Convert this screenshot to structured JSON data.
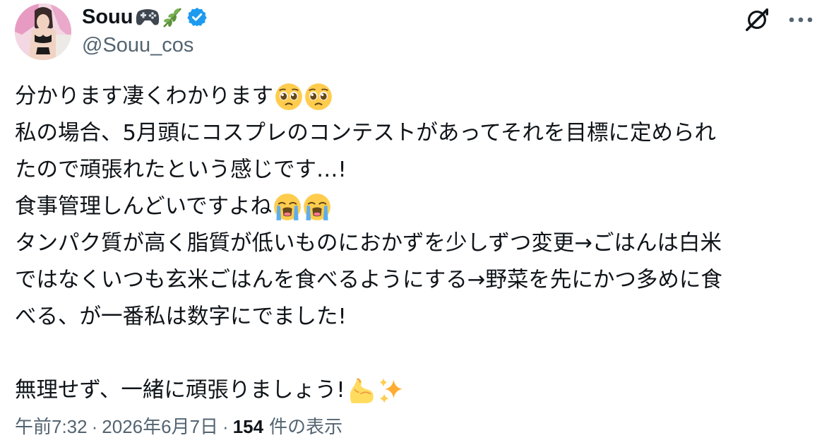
{
  "author": {
    "display_name": "Souu",
    "name_emojis": [
      "video-game-controller-emoji",
      "herb-emoji"
    ],
    "verified": true,
    "handle": "@Souu_cos"
  },
  "top_icons": [
    "grok-icon",
    "more-options-icon"
  ],
  "post": {
    "lines": [
      {
        "text": "分かります凄くわかります",
        "emojis": [
          "pleading-face-emoji",
          "pleading-face-emoji"
        ]
      },
      {
        "text": "私の場合、5月頭にコスプレのコンテストがあってそれを目標に定められ",
        "emojis": []
      },
      {
        "text": "たので頑張れたという感じです…!",
        "emojis": []
      },
      {
        "text": "食事管理しんどいですよね",
        "emojis": [
          "loudly-crying-face-emoji",
          "loudly-crying-face-emoji"
        ]
      },
      {
        "text": "タンパク質が高く脂質が低いものにおかずを少しずつ変更→ごはんは白米",
        "emojis": []
      },
      {
        "text": "ではなくいつも玄米ごはんを食べるようにする→野菜を先にかつ多めに食",
        "emojis": []
      },
      {
        "text": "べる、が一番私は数字にでました!",
        "emojis": []
      },
      {
        "text": "",
        "emojis": []
      },
      {
        "text": "無理せず、一緒に頑張りましょう!",
        "emojis": [
          "flexed-biceps-emoji",
          "sparkles-emoji"
        ]
      }
    ]
  },
  "meta": {
    "time": "午前7:32",
    "separator": "·",
    "date": "2026年6月7日",
    "views_count": "154",
    "views_label": "件の表示"
  },
  "colors": {
    "text": "#0f1419",
    "secondary": "#536471",
    "verified_blue": "#1d9bf0"
  }
}
